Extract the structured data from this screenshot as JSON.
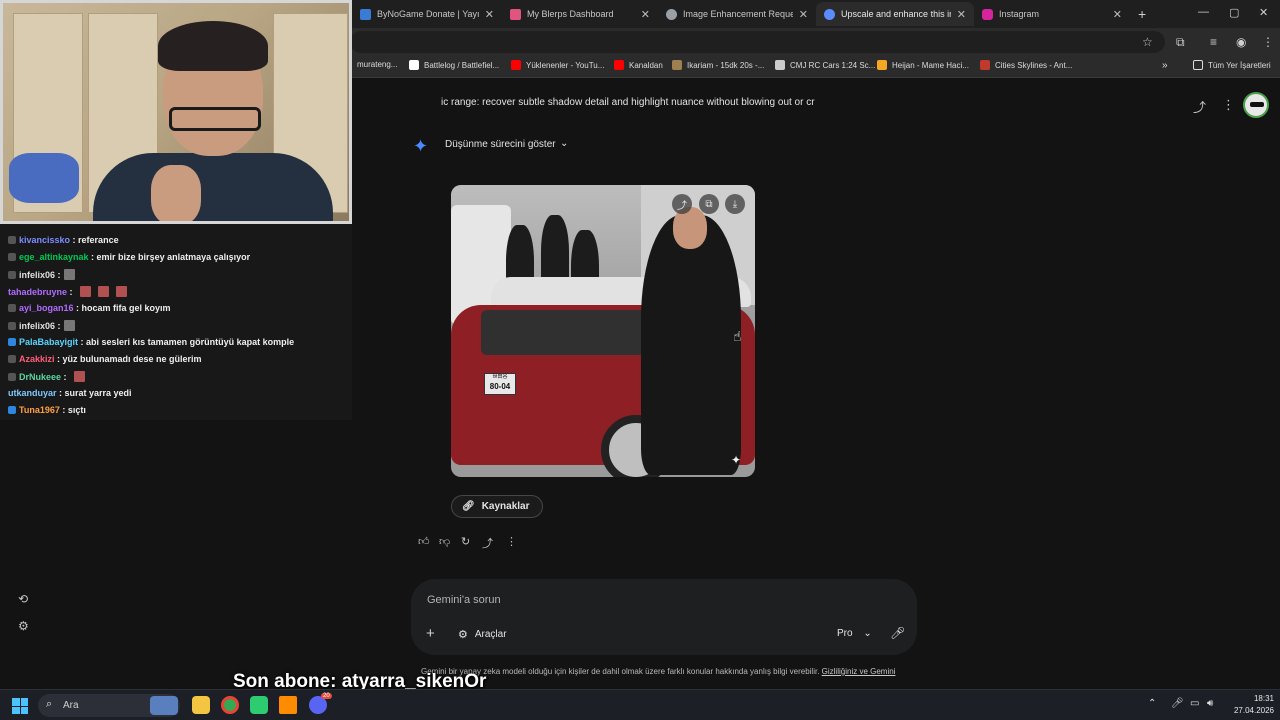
{
  "browser": {
    "tabs": [
      {
        "title": "ByNoGame Donate | Yayıncıya",
        "color": "#3a7bd5"
      },
      {
        "title": "My Blerps Dashboard",
        "color": "#e05580"
      },
      {
        "title": "Image Enhancement Request",
        "color": "#9aa0a6"
      },
      {
        "title": "Upscale and enhance this imag",
        "color": "#5b8cff",
        "active": true
      },
      {
        "title": "Instagram",
        "color": "#d6249f"
      }
    ],
    "new_tab": "+",
    "bookmarks": [
      {
        "label": "murateng...",
        "color": "#6d6d6d"
      },
      {
        "label": "Battlelog / Battlefiel...",
        "color": "#ffffff"
      },
      {
        "label": "Yüklenenler - YouTu...",
        "color": "#ff0000"
      },
      {
        "label": "Kanaldan",
        "color": "#ff0000"
      },
      {
        "label": "Ikariam - 15dk 20s -...",
        "color": "#a08050"
      },
      {
        "label": "CMJ RC Cars 1:24 Sc...",
        "color": "#cccccc"
      },
      {
        "label": "Heijan - Mame Haci...",
        "color": "#f5a623"
      },
      {
        "label": "Cities Skylines - Ant...",
        "color": "#c0392b"
      }
    ],
    "bookmarks_more": "»",
    "all_bookmarks": "Tüm Yer İşaretleri"
  },
  "chat": [
    {
      "user": "kivancissko",
      "message": "referance",
      "color": "#7b8cff",
      "badge": "#555555"
    },
    {
      "user": "ege_altinkaynak",
      "message": "emir bize birşey anlatmaya çalışıyor",
      "color": "#00c853",
      "badge": "#555555"
    },
    {
      "user": "infelix06",
      "message": "",
      "color": "#e0e0e0",
      "badge": "#555555",
      "emotes": 1
    },
    {
      "user": "tahadebruyne",
      "message": "",
      "color": "#b06cff",
      "badge": "",
      "emotes": 3
    },
    {
      "user": "ayi_bogan16",
      "message": "hocam fifa gel koyım",
      "color": "#b06cff",
      "badge": "#555555"
    },
    {
      "user": "infelix06",
      "message": "",
      "color": "#e0e0e0",
      "badge": "#555555",
      "emotes": 1
    },
    {
      "user": "PalaBabayigit",
      "message": "abi sesleri kıs tamamen görüntüyü kapat komple",
      "color": "#5ad5ff",
      "badge": "#2e86de"
    },
    {
      "user": "Azakkizi",
      "message": "yüz bulunamadı dese ne gülerim",
      "color": "#ff5e7a",
      "badge": "#555555"
    },
    {
      "user": "DrNukeee",
      "message": "",
      "color": "#5ad5a0",
      "badge": "#555555",
      "emotes": 1
    },
    {
      "user": "utkanduyar",
      "message": "surat yarra yedi",
      "color": "#7ec8ff",
      "badge": ""
    },
    {
      "user": "Tuna1967",
      "message": "sıçtı",
      "color": "#ff9f43",
      "badge": "#2e86de"
    }
  ],
  "gemini": {
    "prompt_title": "ic range: recover subtle shadow detail and highlight nuance without blowing out or cr",
    "thinking_label": "Düşünme sürecini göster",
    "sources_label": "Kaynaklar",
    "input_placeholder": "Gemini'a sorun",
    "tools_label": "Araçlar",
    "model_label": "Pro",
    "disclaimer": "Gemini bir yapay zeka modeli olduğu için kişiler de dahil olmak üzere farklı konular hakkında yanlış bilgi verebilir.",
    "disclaimer_link": "Gizliliğiniz ve Gemini",
    "image": {
      "plate_text": "80-04",
      "plate_top": "世田谷"
    }
  },
  "overlay": {
    "last_subscriber": "Son abone: atyarra_sikenOr"
  },
  "taskbar": {
    "search_label": "Ara",
    "time": "18:31",
    "date": "27.04.2026",
    "badge_count": "20"
  }
}
